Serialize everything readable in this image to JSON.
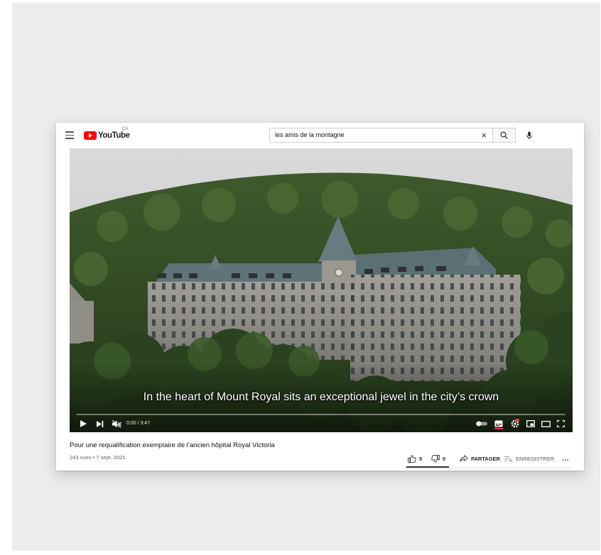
{
  "header": {
    "logo_text": "YouTube",
    "country_code": "CA",
    "search": {
      "value": "les amis de la montagne",
      "clear_symbol": "×"
    },
    "icons": [
      "menu-icon",
      "youtube-logo-icon",
      "close-icon",
      "search-icon",
      "microphone-icon"
    ]
  },
  "player": {
    "caption": "In the heart of Mount Royal sits an exceptional jewel in the city’s crown",
    "time": "0:00 / 3:47",
    "progress": 0.0,
    "icons": [
      "play-icon",
      "next-icon",
      "volume-muted-icon",
      "autoplay-toggle-icon",
      "subtitles-icon",
      "settings-icon",
      "miniplayer-icon",
      "theater-mode-icon",
      "fullscreen-icon"
    ]
  },
  "video": {
    "title": "Pour une requalification exemplaire de l’ancien hôpital Royal Victoria",
    "meta": "243 vues • 7 sept. 2021",
    "likes": "5",
    "dislikes": "0",
    "share_label": "PARTAGER",
    "save_label": "ENREGISTRER",
    "more_symbol": "…"
  },
  "colors": {
    "page_background": "#ececec",
    "brand_red": "#ff0000",
    "sky": "#cfcfcf",
    "forest": "#2f4a22",
    "building_stone": "#8f8d86",
    "roof": "#5c7277"
  }
}
